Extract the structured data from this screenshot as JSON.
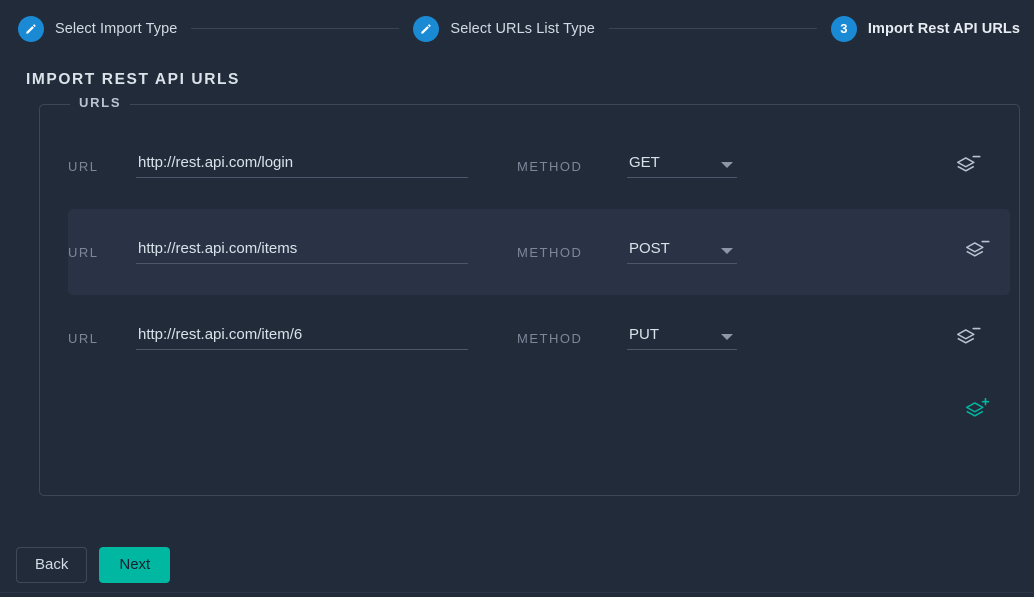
{
  "stepper": {
    "steps": [
      {
        "label": "Select Import Type",
        "icon": "pencil-icon",
        "state": "done"
      },
      {
        "label": "Select URLs List Type",
        "icon": "pencil-icon",
        "state": "done"
      },
      {
        "label": "Import Rest API URLs",
        "number": "3",
        "state": "active"
      }
    ],
    "accent_color": "#1b8ad5"
  },
  "page_title": "IMPORT REST API URLS",
  "urls_group": {
    "legend": "URLS",
    "labels": {
      "url": "URL",
      "method": "METHOD"
    },
    "rows": [
      {
        "url": "http://rest.api.com/login",
        "method": "GET",
        "remove_icon": "layers-remove-icon",
        "highlighted": false
      },
      {
        "url": "http://rest.api.com/items",
        "method": "POST",
        "remove_icon": "layers-remove-icon",
        "highlighted": true
      },
      {
        "url": "http://rest.api.com/item/6",
        "method": "PUT",
        "remove_icon": "layers-remove-icon",
        "highlighted": false
      }
    ],
    "add_icon": "layers-add-icon",
    "add_icon_color": "#00b7a2"
  },
  "footer": {
    "back_label": "Back",
    "next_label": "Next",
    "next_color": "#00b7a2"
  }
}
